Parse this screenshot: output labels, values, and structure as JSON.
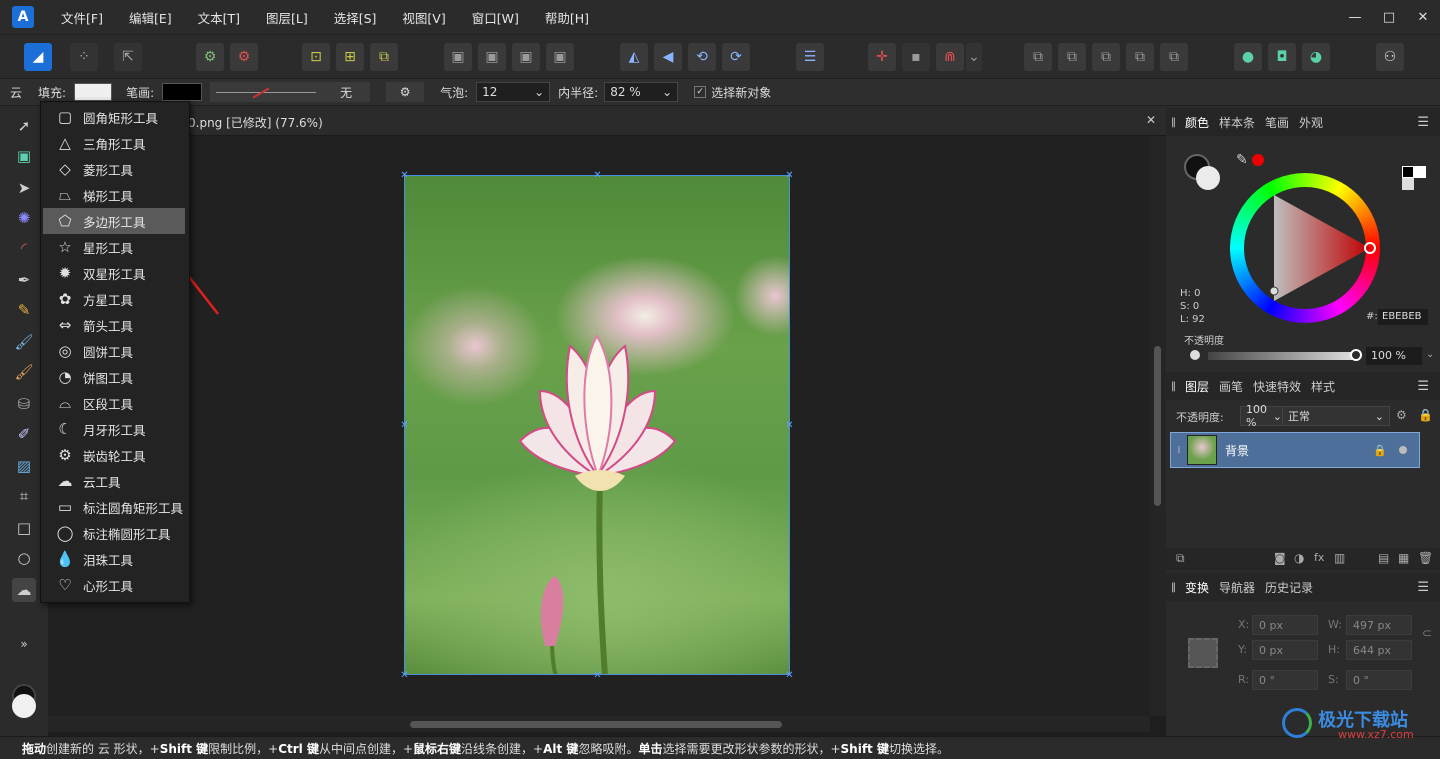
{
  "menu": {
    "logo": "A",
    "items": [
      "文件[F]",
      "编辑[E]",
      "文本[T]",
      "图层[L]",
      "选择[S]",
      "视图[V]",
      "窗口[W]",
      "帮助[H]"
    ],
    "window_controls": [
      "—",
      "□",
      "✕"
    ]
  },
  "context": {
    "tool_name": "云",
    "fill_label": "填充:",
    "stroke_label": "笔画:",
    "stroke_style": "无",
    "bubble_label": "气泡:",
    "bubble_value": "12",
    "inner_radius_label": "内半径:",
    "inner_radius_value": "82 %",
    "select_new_label": "选择新对象",
    "fill_color": "#f0f0f0",
    "stroke_color": "#000000"
  },
  "document": {
    "tab_title": "0.png [已修改] (77.6%)",
    "close": "✕"
  },
  "flyout": {
    "items": [
      {
        "icon": "rounded-rect-icon",
        "glyph": "▢",
        "label": "圆角矩形工具"
      },
      {
        "icon": "triangle-icon",
        "glyph": "△",
        "label": "三角形工具"
      },
      {
        "icon": "diamond-icon",
        "glyph": "◇",
        "label": "菱形工具"
      },
      {
        "icon": "trapezoid-icon",
        "glyph": "⏢",
        "label": "梯形工具"
      },
      {
        "icon": "polygon-icon",
        "glyph": "⬠",
        "label": "多边形工具",
        "selected": true
      },
      {
        "icon": "star-icon",
        "glyph": "☆",
        "label": "星形工具"
      },
      {
        "icon": "double-star-icon",
        "glyph": "✹",
        "label": "双星形工具"
      },
      {
        "icon": "square-star-icon",
        "glyph": "✿",
        "label": "方星工具"
      },
      {
        "icon": "arrow-icon",
        "glyph": "⇔",
        "label": "箭头工具"
      },
      {
        "icon": "donut-icon",
        "glyph": "◎",
        "label": "圆饼工具"
      },
      {
        "icon": "pie-icon",
        "glyph": "◔",
        "label": "饼图工具"
      },
      {
        "icon": "segment-icon",
        "glyph": "⌓",
        "label": "区段工具"
      },
      {
        "icon": "crescent-icon",
        "glyph": "☾",
        "label": "月牙形工具"
      },
      {
        "icon": "cog-icon",
        "glyph": "⚙",
        "label": "嵌齿轮工具"
      },
      {
        "icon": "cloud-icon",
        "glyph": "☁",
        "label": "云工具"
      },
      {
        "icon": "callout-rounded-rect-icon",
        "glyph": "▭",
        "label": "标注圆角矩形工具"
      },
      {
        "icon": "callout-ellipse-icon",
        "glyph": "◯",
        "label": "标注椭圆形工具"
      },
      {
        "icon": "teardrop-icon",
        "glyph": "💧",
        "label": "泪珠工具"
      },
      {
        "icon": "heart-icon",
        "glyph": "♡",
        "label": "心形工具"
      }
    ]
  },
  "color_panel": {
    "tabs": [
      "颜色",
      "样本条",
      "笔画",
      "外观"
    ],
    "hsl": {
      "h": "H: 0",
      "s": "S: 0",
      "l": "L: 92"
    },
    "hex_label": "#:",
    "hex_value": "EBEBEB",
    "opacity_label": "不透明度",
    "opacity_value": "100 %"
  },
  "layers_panel": {
    "tabs": [
      "图层",
      "画笔",
      "快速特效",
      "样式"
    ],
    "opacity_label": "不透明度:",
    "opacity_value": "100 %",
    "blend_mode": "正常",
    "layer_name": "背景"
  },
  "transform_panel": {
    "tabs": [
      "变换",
      "导航器",
      "历史记录"
    ],
    "x_label": "X:",
    "x_value": "0 px",
    "y_label": "Y:",
    "y_value": "0 px",
    "w_label": "W:",
    "w_value": "497 px",
    "h_label": "H:",
    "h_value": "644 px",
    "r_label": "R:",
    "r_value": "0 °",
    "s_label": "S:",
    "s_value": "0 °"
  },
  "status": {
    "p1b": "拖动",
    "p1": " 创建新的 云 形状，+",
    "p2b": "Shift 键",
    "p2": " 限制比例，+",
    "p3b": "Ctrl 键",
    "p3": " 从中间点创建，+",
    "p4b": "鼠标右键",
    "p4": " 沿线条创建，+",
    "p5b": "Alt 键",
    "p5": " 忽略吸附。",
    "p6b": "单击",
    "p6": " 选择需要更改形状参数的形状，+",
    "p7b": "Shift 键",
    "p7": " 切换选择。"
  },
  "watermark": {
    "text": "极光下载站",
    "url": "www.xz7.com"
  }
}
